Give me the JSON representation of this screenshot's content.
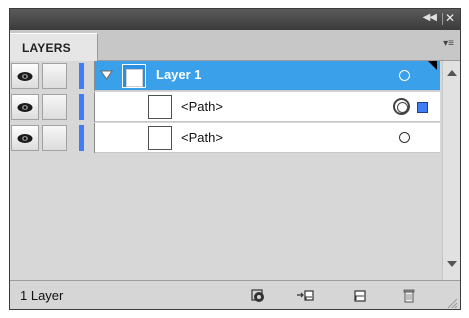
{
  "panel": {
    "tab_label": "LAYERS",
    "collapse_icon": "double-chevron-right-icon",
    "close_icon": "close-icon",
    "menu_icon": "panel-menu-icon"
  },
  "rows": [
    {
      "type": "layer",
      "name": "Layer 1",
      "selected": true,
      "expanded": true
    },
    {
      "type": "path",
      "name": "<Path>",
      "selected_art": true
    },
    {
      "type": "path",
      "name": "<Path>",
      "selected_art": false
    }
  ],
  "footer": {
    "status": "1 Layer"
  },
  "colors": {
    "selection": "#3aa0ea",
    "layer_color": "#3f7cf5",
    "titlebar": "#3b3b3b",
    "panel_bg": "#d7d7d7"
  }
}
